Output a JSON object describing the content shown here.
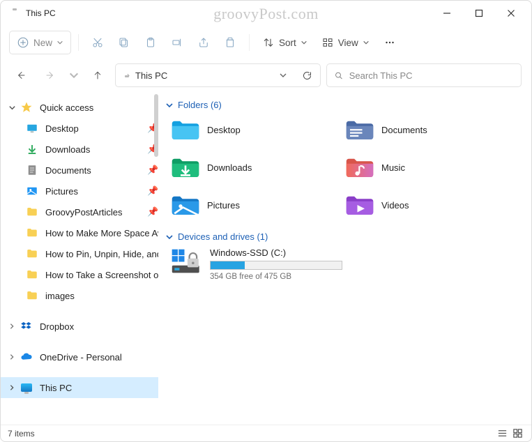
{
  "window": {
    "title": "This PC",
    "watermark": "groovyPost.com"
  },
  "toolbar": {
    "new_label": "New",
    "sort_label": "Sort",
    "view_label": "View"
  },
  "address": {
    "location": "This PC"
  },
  "search": {
    "placeholder": "Search This PC"
  },
  "sidebar": {
    "quick_access": "Quick access",
    "items": [
      {
        "label": "Desktop",
        "icon": "desktop",
        "pinned": true
      },
      {
        "label": "Downloads",
        "icon": "downloads",
        "pinned": true
      },
      {
        "label": "Documents",
        "icon": "documents",
        "pinned": true
      },
      {
        "label": "Pictures",
        "icon": "pictures",
        "pinned": true
      },
      {
        "label": "GroovyPostArticles",
        "icon": "folder",
        "pinned": true
      },
      {
        "label": "How to Make More Space Av",
        "icon": "folder",
        "pinned": false
      },
      {
        "label": "How to Pin, Unpin, Hide, and",
        "icon": "folder",
        "pinned": false
      },
      {
        "label": "How to Take a Screenshot on",
        "icon": "folder",
        "pinned": false
      },
      {
        "label": "images",
        "icon": "folder",
        "pinned": false
      }
    ],
    "dropbox": "Dropbox",
    "onedrive": "OneDrive - Personal",
    "this_pc": "This PC"
  },
  "content": {
    "folders_header": "Folders (6)",
    "folders": [
      {
        "label": "Desktop"
      },
      {
        "label": "Documents"
      },
      {
        "label": "Downloads"
      },
      {
        "label": "Music"
      },
      {
        "label": "Pictures"
      },
      {
        "label": "Videos"
      }
    ],
    "drives_header": "Devices and drives (1)",
    "drive": {
      "label": "Windows-SSD (C:)",
      "subtext": "354 GB free of 475 GB",
      "used_percent": 26
    }
  },
  "status": {
    "items": "7 items"
  }
}
